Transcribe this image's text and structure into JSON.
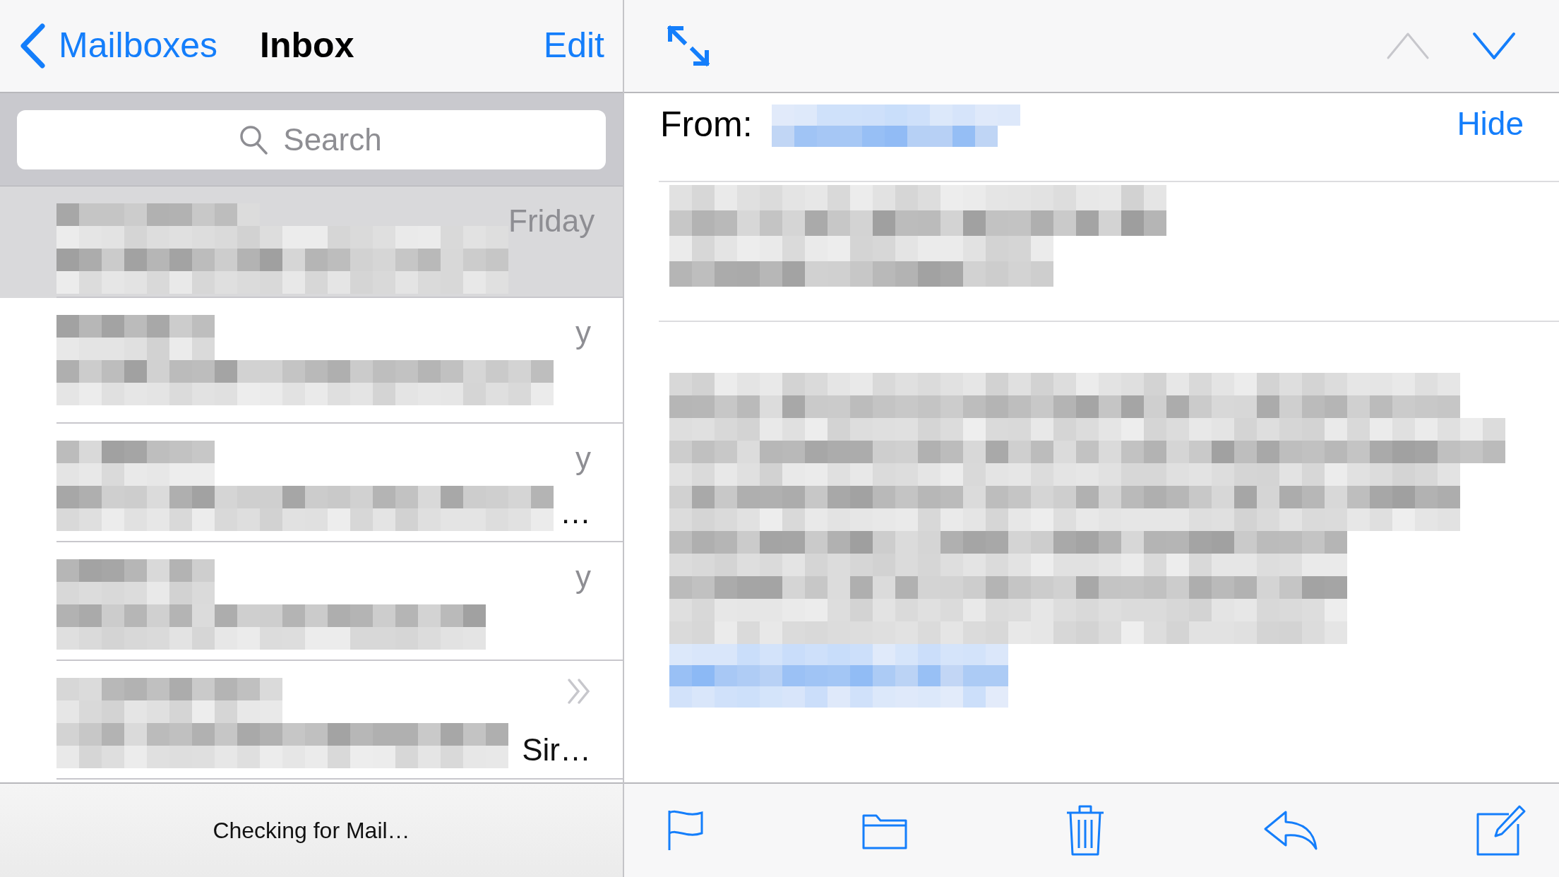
{
  "mailbox_list": {
    "back_label": "Mailboxes",
    "title": "Inbox",
    "edit_label": "Edit"
  },
  "search": {
    "placeholder": "Search"
  },
  "messages": [
    {
      "date": "Friday",
      "selected": true,
      "thread": false
    },
    {
      "date": "y",
      "selected": false,
      "thread": false
    },
    {
      "date": "y",
      "preview_end": "…",
      "selected": false,
      "thread": false
    },
    {
      "date": "y",
      "selected": false,
      "thread": false
    },
    {
      "preview_end": "Sir…",
      "selected": false,
      "thread": true
    }
  ],
  "status_bar": {
    "text": "Checking for Mail…"
  },
  "message_nav": {
    "previous_disabled": true,
    "next_disabled": false
  },
  "header": {
    "from_label": "From:",
    "hide_label": "Hide"
  }
}
